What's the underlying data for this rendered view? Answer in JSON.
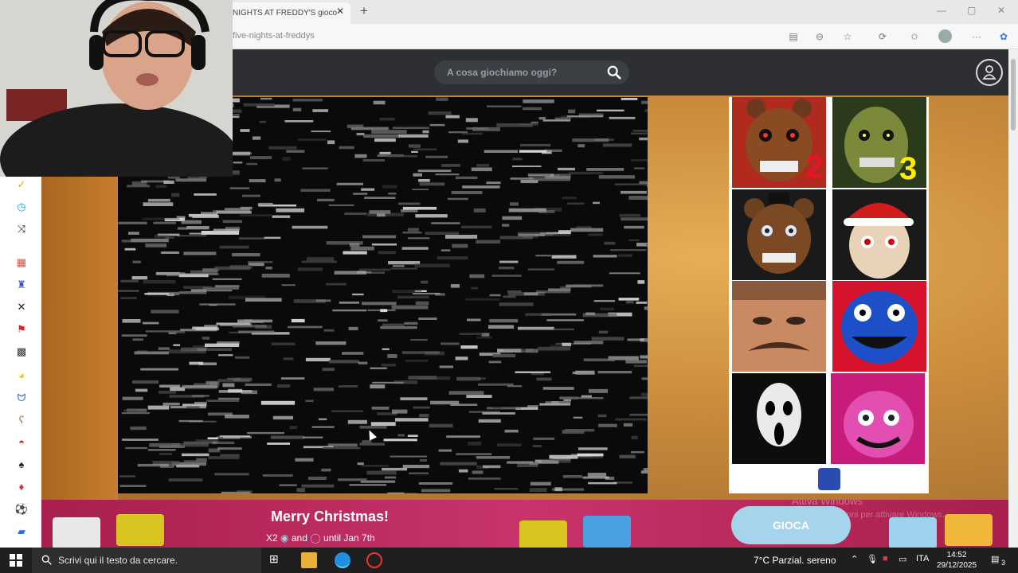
{
  "browser": {
    "tab_title": "NIGHTS AT FREDDY'S gioco",
    "url": "five-nights-at-freddys"
  },
  "site": {
    "search_placeholder": "A cosa giochiamo oggi?"
  },
  "sidebar": {
    "icons": [
      "check-icon",
      "clock-icon",
      "shuffle-icon",
      "grid-icon",
      "controller-icon",
      "swords-icon",
      "flag-icon",
      "checkered-flag-icon",
      "pacman-icon",
      "people-icon",
      "bear-icon",
      "pokeball-icon",
      "spade-icon",
      "cards-icon",
      "soccer-ball-icon",
      "car-icon"
    ]
  },
  "ad": {
    "tiles": [
      {
        "name": "freddy-2-thumb",
        "badge": "2"
      },
      {
        "name": "springtrap-3-thumb",
        "badge": "3"
      },
      {
        "name": "freddy-thumb",
        "badge": ""
      },
      {
        "name": "santa-doll-thumb",
        "badge": ""
      },
      {
        "name": "neighbor-thumb",
        "badge": ""
      },
      {
        "name": "huggy-wuggy-thumb",
        "badge": ""
      },
      {
        "name": "scream-mask-thumb",
        "badge": ""
      },
      {
        "name": "mommy-long-legs-thumb",
        "badge": ""
      }
    ]
  },
  "banner": {
    "title": "Merry Christmas!",
    "subtitle_prefix": "X2",
    "subtitle_mid": "and",
    "subtitle_suffix": "until Jan 7th",
    "play_label": "GIOCA",
    "watermark_line1": "Attiva Windows",
    "watermark_line2": "stazioni per attivare Windows."
  },
  "taskbar": {
    "search_placeholder": "Scrivi qui il testo da cercare.",
    "weather": "7°C  Parzial. sereno",
    "language": "ITA",
    "time": "14:52",
    "date": "29/12/2025",
    "notification_count": "3"
  },
  "colors": {
    "header": "#2d2f33",
    "banner": "#c8346b",
    "play_button": "#a6d4ec",
    "taskbar": "#1f1f1f"
  }
}
